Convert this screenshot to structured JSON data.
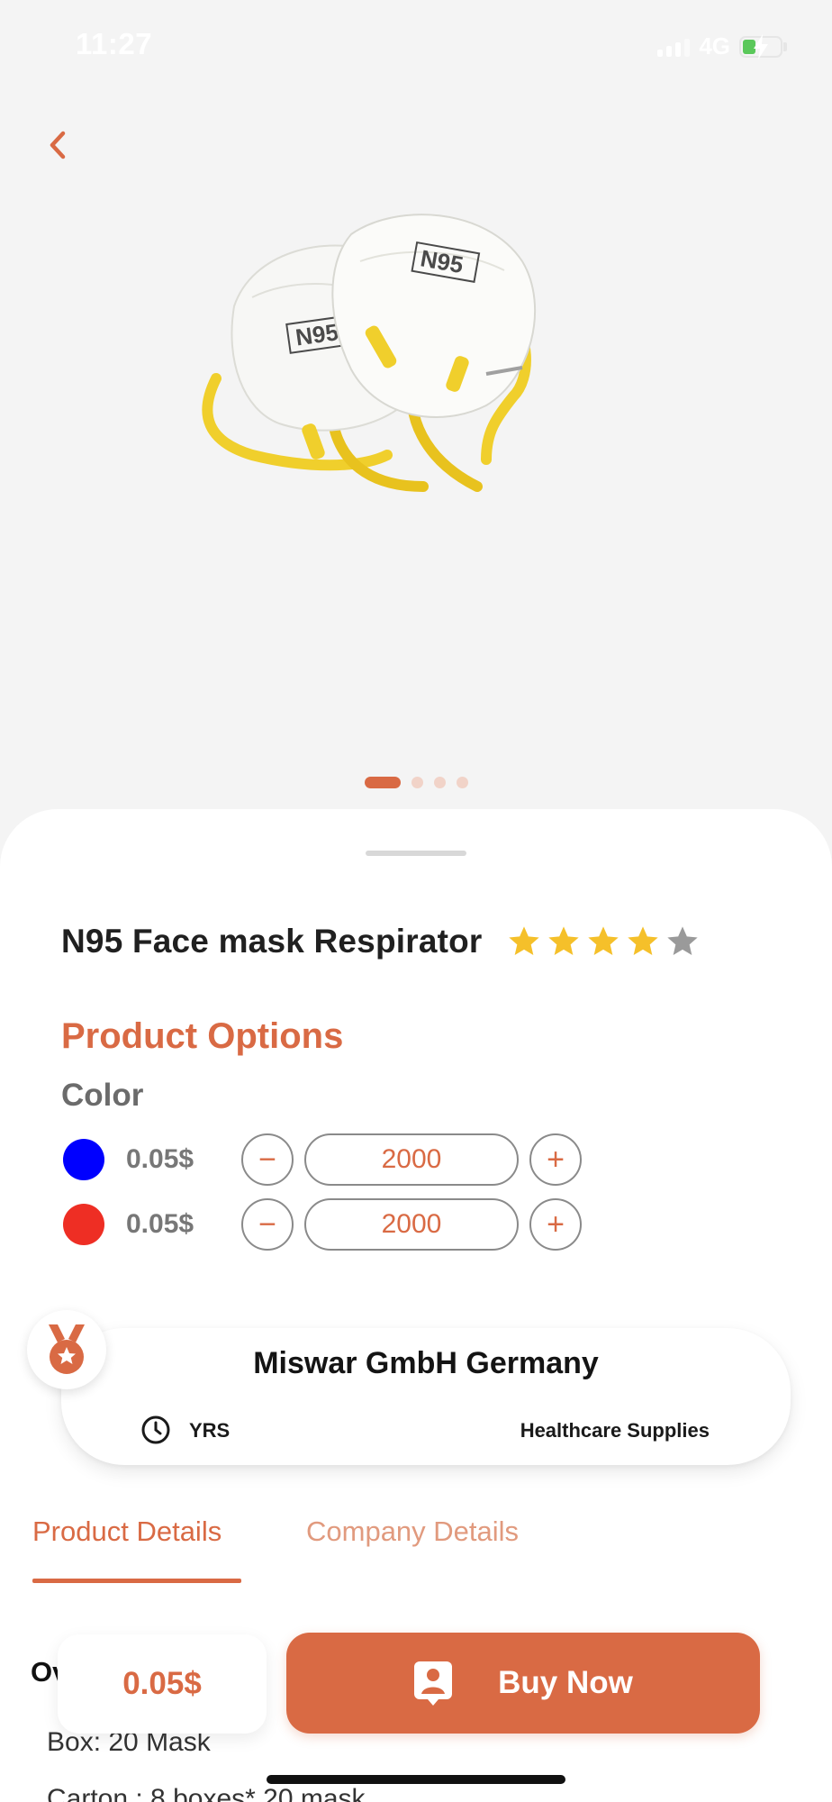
{
  "status": {
    "time": "11:27",
    "network": "4G"
  },
  "product": {
    "title": "N95 Face mask Respirator",
    "rating": 4,
    "rating_max": 5,
    "image_pages": 4,
    "image_active_page": 1
  },
  "options": {
    "section_title": "Product Options",
    "color_label": "Color",
    "rows": [
      {
        "color": "#0000ff",
        "price": "0.05$",
        "quantity": "2000",
        "minus": "−",
        "plus": "+"
      },
      {
        "color": "#ee2e24",
        "price": "0.05$",
        "quantity": "2000",
        "minus": "−",
        "plus": "+"
      }
    ]
  },
  "company": {
    "name": "Miswar GmbH Germany",
    "years": "YRS",
    "category": "Healthcare Supplies"
  },
  "tabs": {
    "product_details": "Product Details",
    "company_details": "Company Details"
  },
  "details": {
    "overview_label": "Ov",
    "box": "Box: 20 Mask",
    "carton": "Carton : 8 boxes* 20 mask"
  },
  "footer": {
    "price": "0.05$",
    "buy_label": "Buy Now"
  },
  "colors": {
    "accent": "#d96a44",
    "star_filled": "#f5c02a",
    "star_empty": "#9a9a9a"
  }
}
